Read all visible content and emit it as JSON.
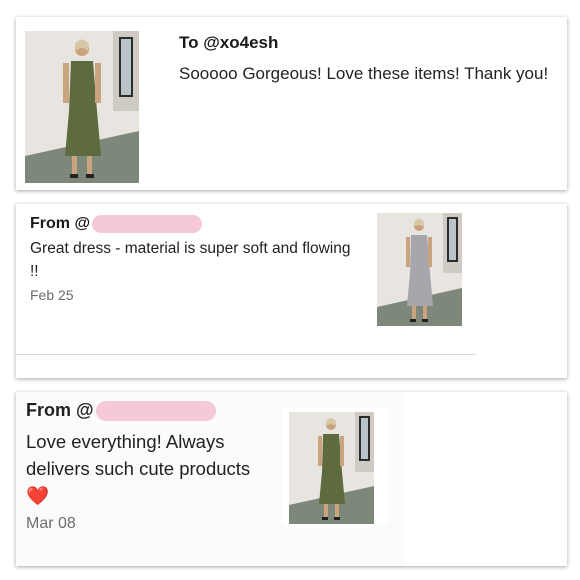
{
  "reviews": [
    {
      "heading": "To @xo4esh",
      "message": "Sooooo Gorgeous! Love these items! Thank you!",
      "image": "model-olive-dress-photo"
    },
    {
      "heading": "From @",
      "message": "Great dress - material is super soft and flowing !!",
      "date": "Feb 25",
      "image": "model-grey-dress-photo"
    },
    {
      "heading": "From @",
      "message": "Love everything! Always delivers such cute products",
      "emoji": "❤️",
      "date": "Mar 08",
      "image": "model-olive-dress-photo"
    }
  ],
  "colors": {
    "redaction": "#f6c9d8",
    "olive_dress": "#5e6b3e",
    "grey_dress": "#a6a6ac",
    "date_text": "#6d6d6d"
  }
}
